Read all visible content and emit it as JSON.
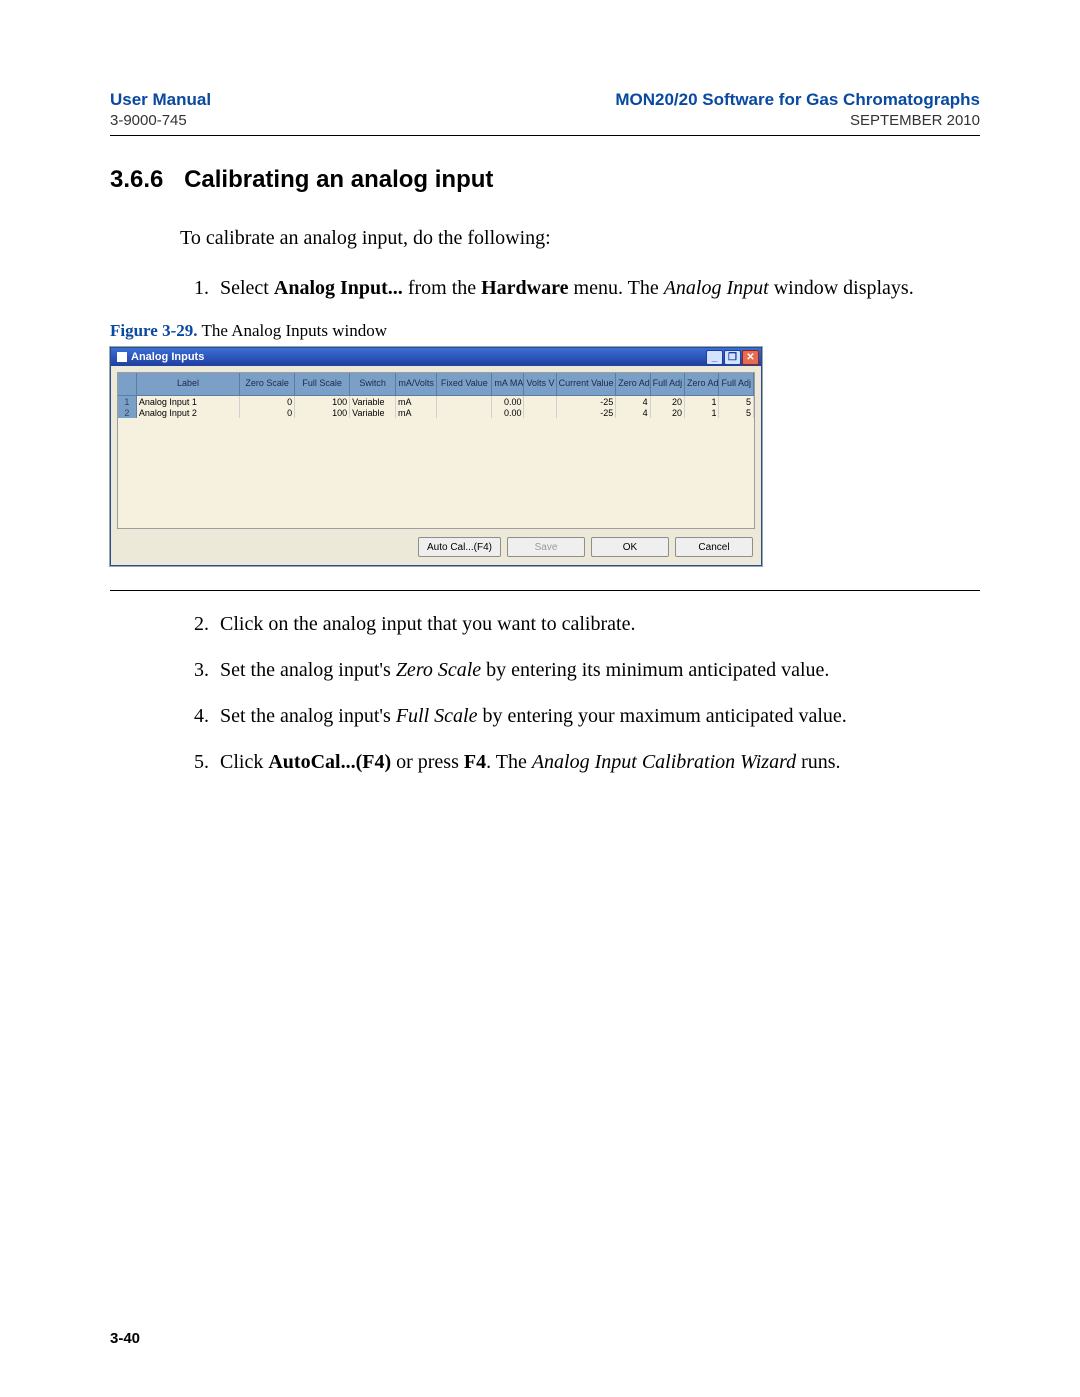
{
  "header": {
    "left_title": "User Manual",
    "left_sub": "3-9000-745",
    "right_title": "MON20/20 Software for Gas Chromatographs",
    "right_sub": "SEPTEMBER 2010"
  },
  "section": {
    "number": "3.6.6",
    "title": "Calibrating an analog input"
  },
  "intro": "To calibrate an analog input, do the following:",
  "step1": {
    "pre": "Select ",
    "b1": "Analog Input...",
    "mid": " from the ",
    "b2": "Hardware",
    "post1": " menu.  The ",
    "i1": "Analog Input",
    "post2": " window displays."
  },
  "figure": {
    "label": "Figure 3-29.",
    "caption": "  The Analog Inputs window"
  },
  "window": {
    "title": "Analog Inputs",
    "columns": [
      "",
      "Label",
      "Zero Scale",
      "Full Scale",
      "Switch",
      "mA/Volts",
      "Fixed Value",
      "mA MA",
      "Volts V",
      "Current Value",
      "Zero Adj MA",
      "Full Adj MA",
      "Zero Adj V",
      "Full Adj V"
    ],
    "rows": [
      {
        "num": "1",
        "label": "Analog Input 1",
        "zero": "0",
        "full": "100",
        "switch": "Variable",
        "units": "mA",
        "fixed": "",
        "ma": "0.00",
        "v": "",
        "cur": "-25",
        "za": "4",
        "fa": "20",
        "zv": "1",
        "fv": "5"
      },
      {
        "num": "2",
        "label": "Analog Input 2",
        "zero": "0",
        "full": "100",
        "switch": "Variable",
        "units": "mA",
        "fixed": "",
        "ma": "0.00",
        "v": "",
        "cur": "-25",
        "za": "4",
        "fa": "20",
        "zv": "1",
        "fv": "5"
      }
    ],
    "buttons": {
      "autocal": "Auto Cal...(F4)",
      "save": "Save",
      "ok": "OK",
      "cancel": "Cancel"
    }
  },
  "step2": "Click on the analog input that you want to calibrate.",
  "step3": {
    "pre": "Set the analog input's ",
    "i1": "Zero Scale",
    "post": " by entering its minimum anticipated value."
  },
  "step4": {
    "pre": "Set the analog input's ",
    "i1": "Full Scale",
    "post": " by entering your maximum anticipated value."
  },
  "step5": {
    "pre": "Click ",
    "b1": "AutoCal...(F4)",
    "mid1": " or press ",
    "b2": "F4",
    "mid2": ".  The ",
    "i1": "Analog Input Calibration Wizard",
    "post": " runs."
  },
  "page_number": "3-40"
}
